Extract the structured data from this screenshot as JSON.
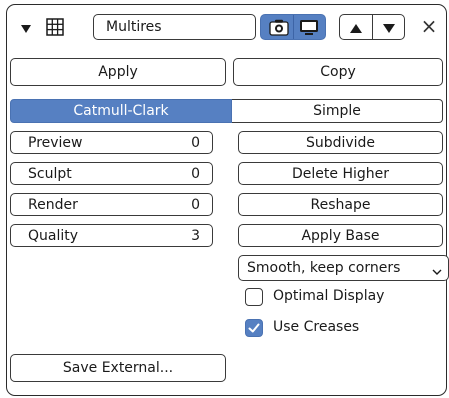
{
  "header": {
    "modifier_name": "Multires",
    "close_glyph": "×"
  },
  "actions": {
    "apply_label": "Apply",
    "copy_label": "Copy"
  },
  "subdivision_type": {
    "options": [
      "Catmull-Clark",
      "Simple"
    ],
    "selected": "Catmull-Clark"
  },
  "levels": [
    {
      "label": "Preview",
      "value": "0"
    },
    {
      "label": "Sculpt",
      "value": "0"
    },
    {
      "label": "Render",
      "value": "0"
    },
    {
      "label": "Quality",
      "value": "3"
    }
  ],
  "operations": {
    "subdivide_label": "Subdivide",
    "delete_higher_label": "Delete Higher",
    "reshape_label": "Reshape",
    "apply_base_label": "Apply Base"
  },
  "uv_smooth": {
    "selected": "Smooth, keep corners"
  },
  "options": {
    "optimal_display": {
      "label": "Optimal Display",
      "checked": false
    },
    "use_creases": {
      "label": "Use Creases",
      "checked": true
    }
  },
  "external": {
    "save_label": "Save External..."
  },
  "colors": {
    "accent": "#5680c2",
    "border": "#2b2b2b"
  },
  "icons": [
    "collapse-triangle-icon",
    "modifier-grid-icon",
    "camera-render-icon",
    "monitor-viewport-icon",
    "move-up-icon",
    "move-down-icon",
    "close-icon",
    "dropdown-chevron-icon",
    "checkmark-icon"
  ]
}
